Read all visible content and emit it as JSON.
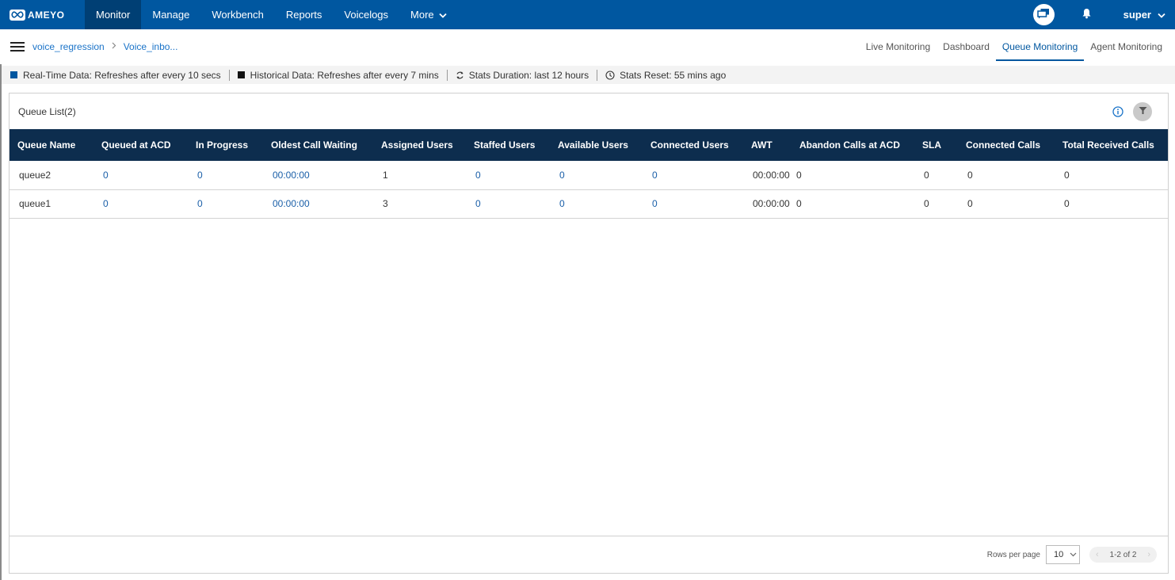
{
  "app": {
    "brand": "AMEYO"
  },
  "nav": {
    "items": [
      {
        "label": "Monitor",
        "active": true
      },
      {
        "label": "Manage",
        "active": false
      },
      {
        "label": "Workbench",
        "active": false
      },
      {
        "label": "Reports",
        "active": false
      },
      {
        "label": "Voicelogs",
        "active": false
      },
      {
        "label": "More",
        "active": false
      }
    ],
    "user": "super"
  },
  "breadcrumb": {
    "items": [
      "voice_regression",
      "Voice_inbo..."
    ]
  },
  "tabs": [
    {
      "label": "Live Monitoring",
      "active": false
    },
    {
      "label": "Dashboard",
      "active": false
    },
    {
      "label": "Queue Monitoring",
      "active": true
    },
    {
      "label": "Agent Monitoring",
      "active": false
    }
  ],
  "infobar": {
    "realtime": "Real-Time Data: Refreshes after every 10 secs",
    "historical": "Historical Data: Refreshes after every 7 mins",
    "duration": "Stats Duration: last 12 hours",
    "reset": "Stats Reset: 55 mins ago",
    "realtime_color": "#0057a0",
    "historical_color": "#111111"
  },
  "panel": {
    "title": "Queue List(2)"
  },
  "table": {
    "columns": [
      "Queue Name",
      "Queued at ACD",
      "In Progress",
      "Oldest Call Waiting",
      "Assigned Users",
      "Staffed Users",
      "Available Users",
      "Connected Users",
      "AWT",
      "Abandon Calls at ACD",
      "SLA",
      "Connected Calls",
      "Total Received Calls"
    ],
    "rows": [
      [
        "queue2",
        "0",
        "0",
        "00:00:00",
        "1",
        "0",
        "0",
        "0",
        "00:00:00",
        "0",
        "0",
        "0",
        "0"
      ],
      [
        "queue1",
        "0",
        "0",
        "00:00:00",
        "3",
        "0",
        "0",
        "0",
        "00:00:00",
        "0",
        "0",
        "0",
        "0"
      ]
    ]
  },
  "footer": {
    "rows_per_page_label": "Rows per page",
    "rows_per_page_value": "10",
    "range": "1-2 of 2"
  }
}
